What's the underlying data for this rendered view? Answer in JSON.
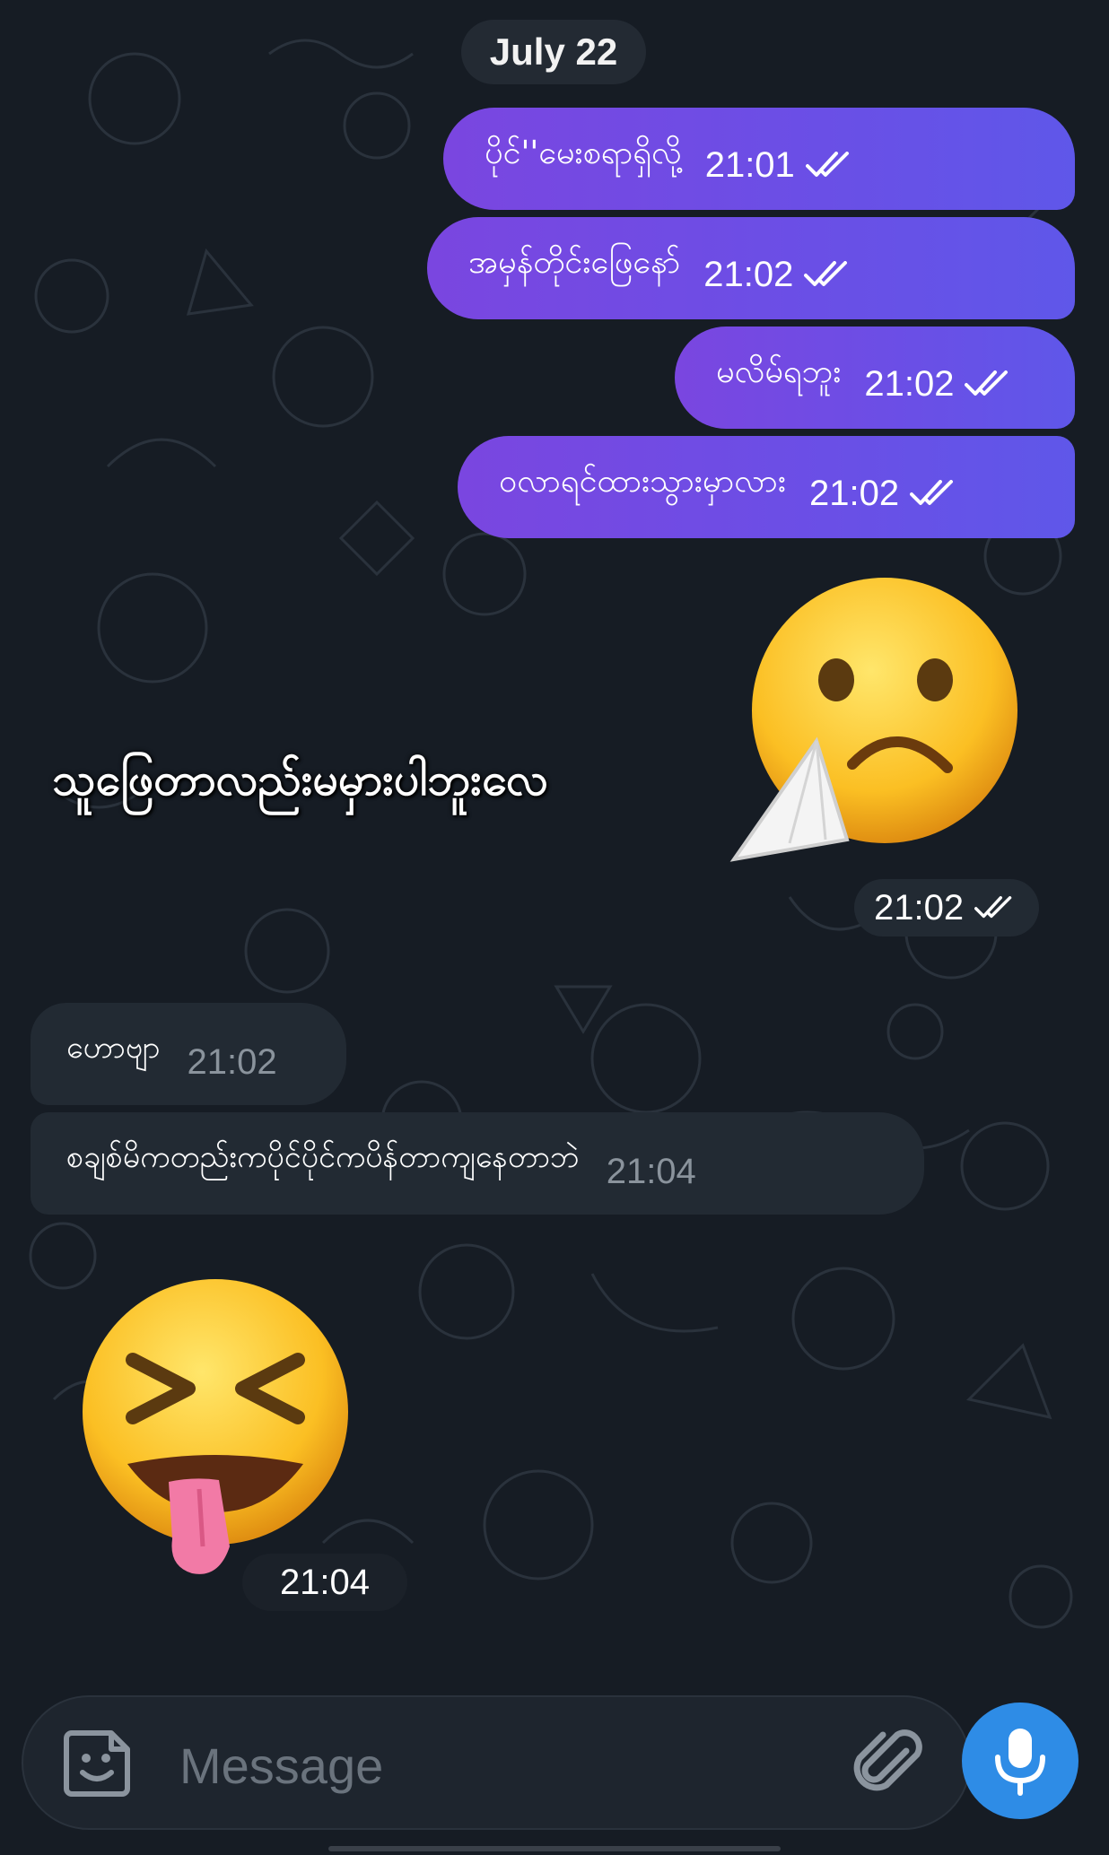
{
  "chat": {
    "date_label": "July 22",
    "outgoing": [
      {
        "text": "ပိုင်''မေးစရာရှိလို့",
        "time": "21:01"
      },
      {
        "text": "အမှန်တိုင်းဖြေနော်",
        "time": "21:02"
      },
      {
        "text": "မလိမ်ရဘူး",
        "time": "21:02"
      },
      {
        "text": "ဝလာရင်ထားသွားမှာလား",
        "time": "21:02"
      }
    ],
    "big_message": {
      "text": "သူဖြေတာလည်းမမှားပါဘူးလေ",
      "emoji": "sad-face-tissue-emoji",
      "time": "21:02"
    },
    "incoming": [
      {
        "text": "ဟောဗျာ",
        "time": "21:02"
      },
      {
        "text": "စချစ်မိကတည်းကပိုင်ပိုင်ကပိန်တာကျနေတာဘဲ",
        "time": "21:04"
      }
    ],
    "sticker": {
      "emoji": "squinting-tongue-emoji",
      "time": "21:04"
    }
  },
  "composer": {
    "placeholder": "Message"
  },
  "colors": {
    "background": "#161c24",
    "outgoing_bubble": "#6a4fe6",
    "incoming_bubble": "#222a33",
    "mic_button": "#2e8ce6"
  }
}
